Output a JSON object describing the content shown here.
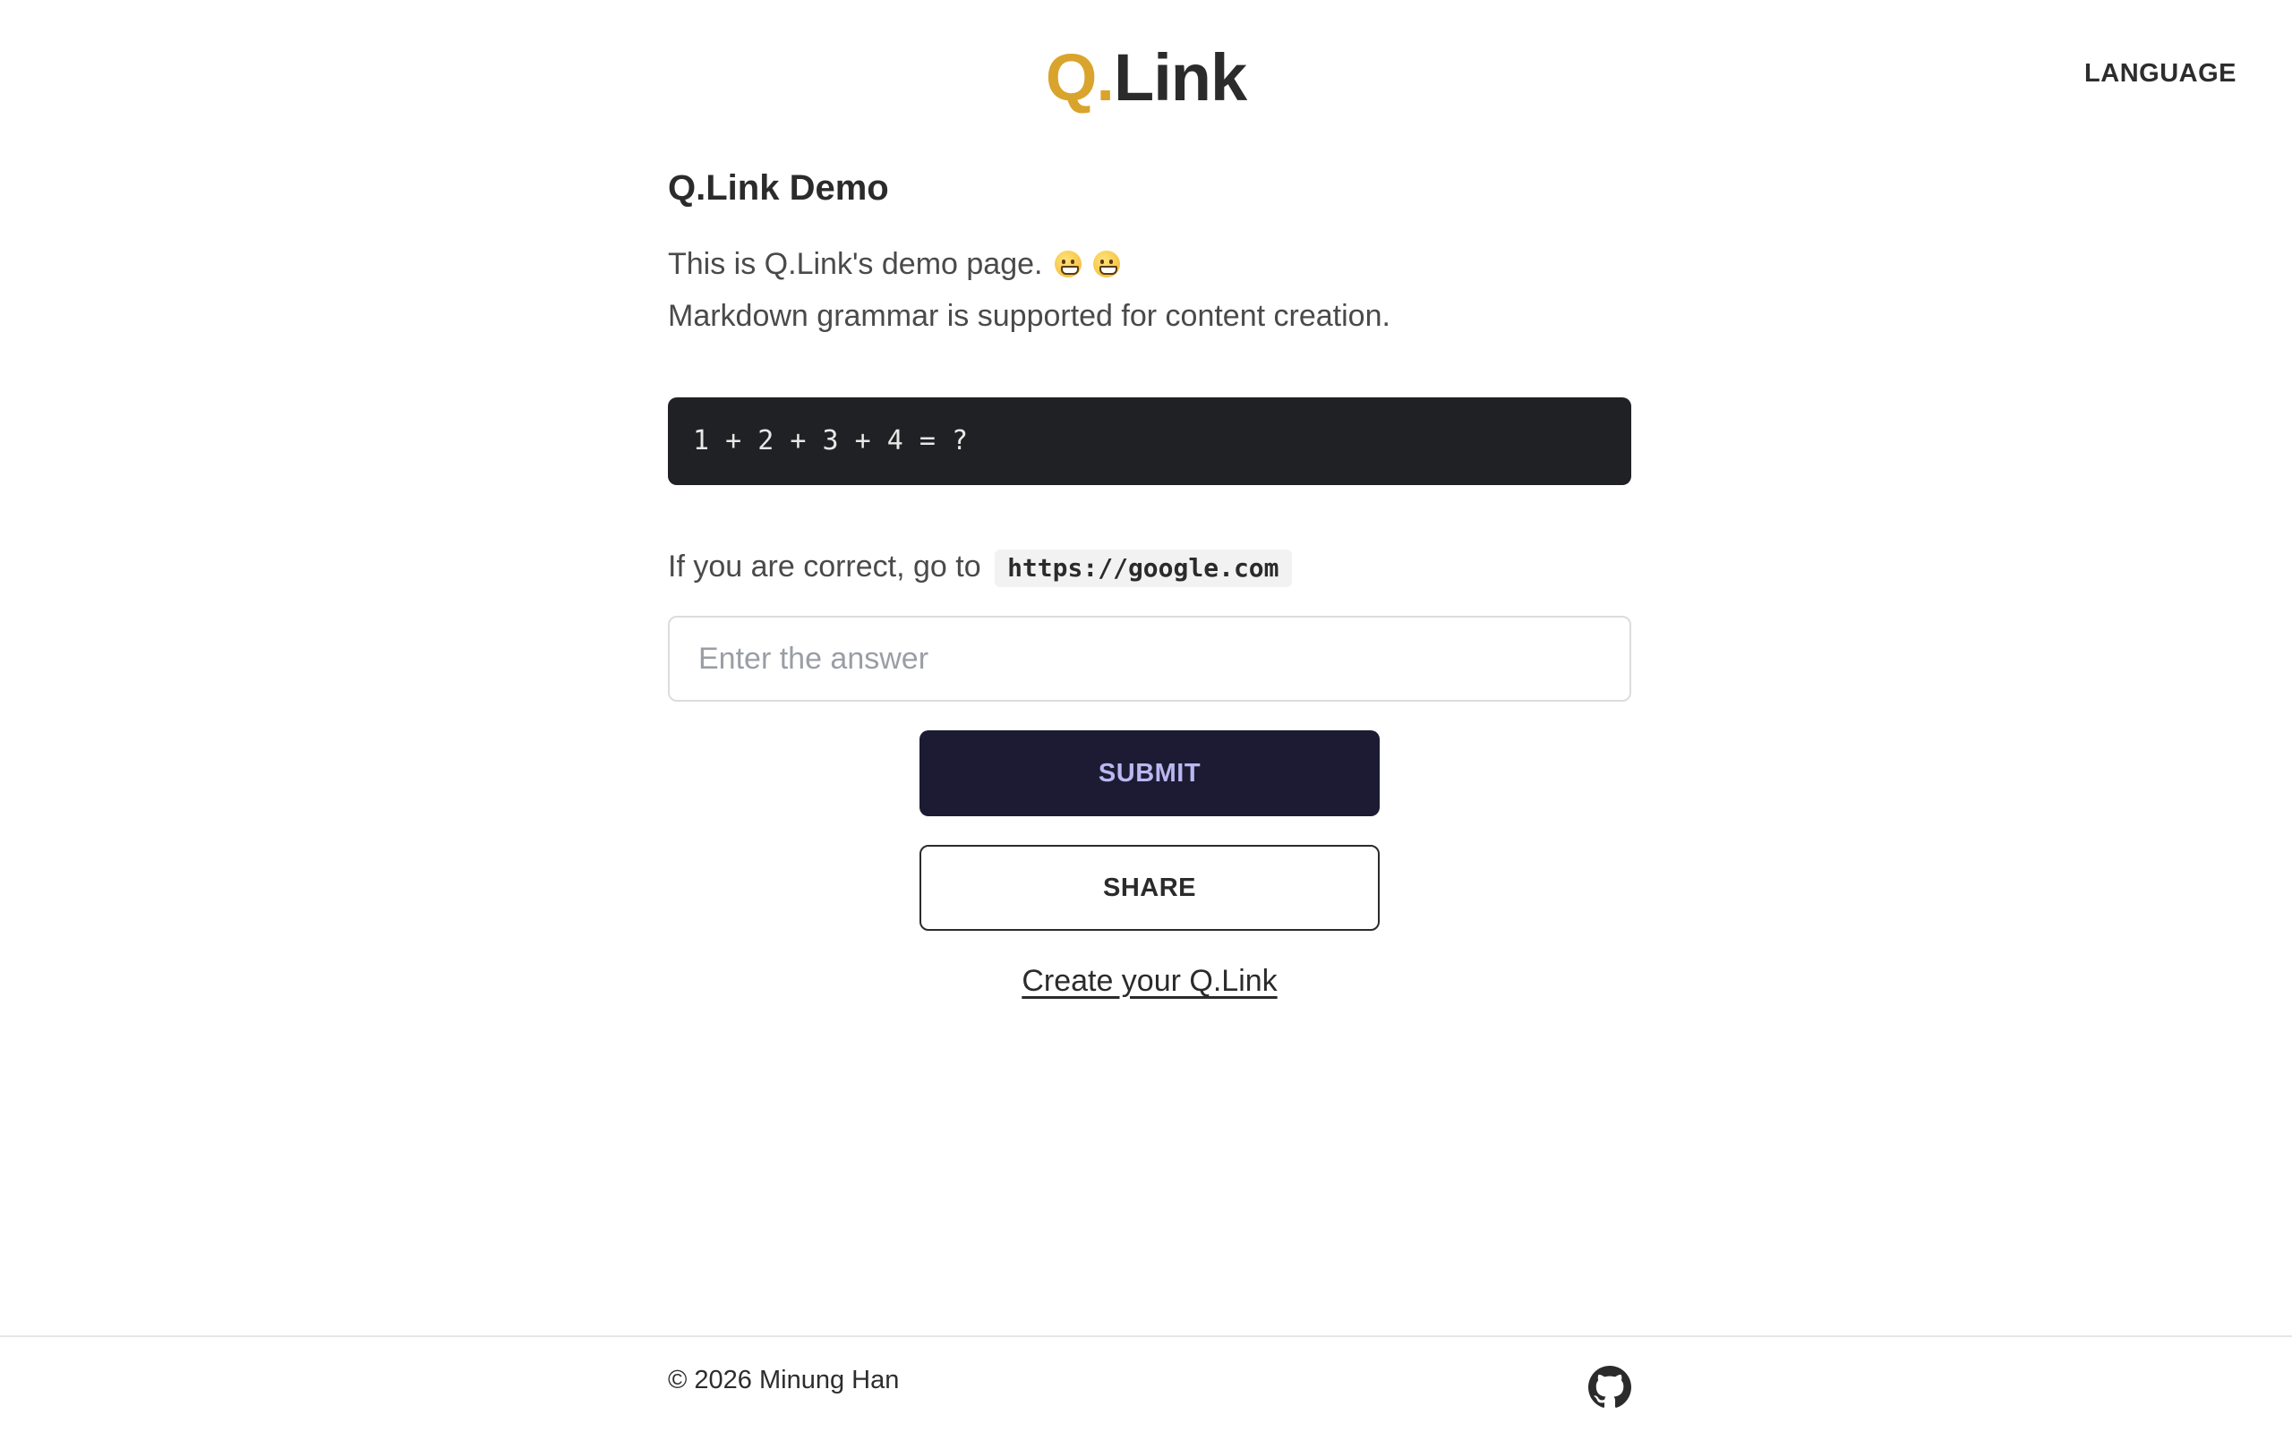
{
  "header": {
    "logo_q": "Q.",
    "logo_rest": "Link",
    "language_label": "LANGUAGE"
  },
  "main": {
    "title": "Q.Link Demo",
    "description_line1": "This is Q.Link's demo page.",
    "description_line2": "Markdown grammar is supported for content creation.",
    "question": "1 + 2 + 3 + 4 = ?",
    "target_prefix": "If you are correct, go to",
    "target_url": "https://google.com",
    "answer_placeholder": "Enter the answer",
    "submit_label": "SUBMIT",
    "share_label": "SHARE",
    "create_link_label": "Create your Q.Link"
  },
  "footer": {
    "copyright": "© 2026 Minung Han",
    "github_icon": "github-icon"
  },
  "colors": {
    "logo_accent": "#d9a42c",
    "submit_bg": "#1c1b33",
    "submit_text": "#b9b8f0",
    "code_bg": "#202124"
  }
}
